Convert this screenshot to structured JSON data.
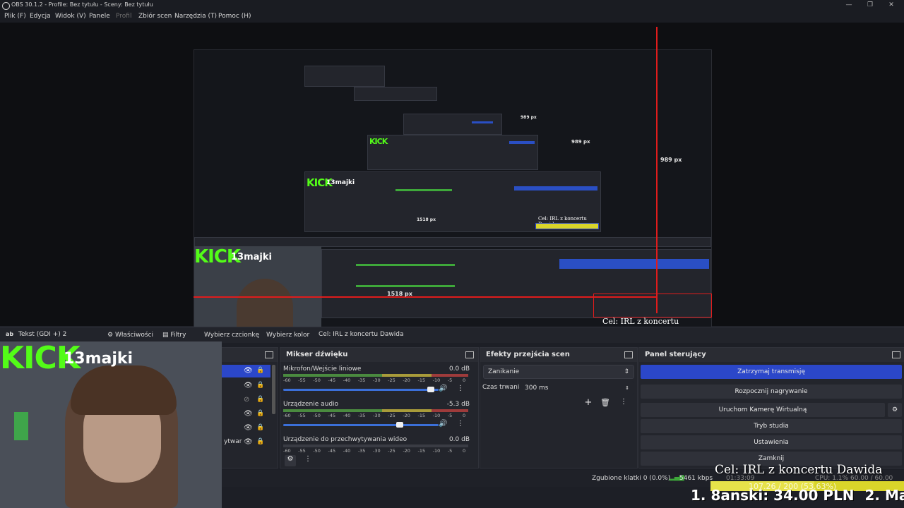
{
  "window": {
    "title": "OBS 30.1.2 - Profile: Bez tytułu - Sceny: Bez tytułu",
    "controls": [
      "—",
      "❐",
      "✕"
    ]
  },
  "menu": [
    {
      "label": "Plik (F)",
      "enabled": true
    },
    {
      "label": "Edycja",
      "enabled": true
    },
    {
      "label": "Widok (V)",
      "enabled": true
    },
    {
      "label": "Panele",
      "enabled": true
    },
    {
      "label": "Profil",
      "enabled": false
    },
    {
      "label": "Zbiór scen",
      "enabled": true
    },
    {
      "label": "Narzędzia (T)",
      "enabled": true
    },
    {
      "label": "Pomoc (H)",
      "enabled": true
    }
  ],
  "preview": {
    "measure_height": "989 px",
    "measure_width": "1518 px",
    "nested_height_2": "989 px",
    "nested_height_3": "989 px",
    "nested_width": "1518 px"
  },
  "properties_bar": {
    "source_icon": "ab",
    "source_name": "Tekst (GDI +) 2",
    "properties_label": "Właściwości",
    "filters_label": "Filtry",
    "choose_font_label": "Wybierz czcionkę",
    "choose_color_label": "Wybierz kolor",
    "text_value": "Cel: IRL z koncertu Dawida"
  },
  "sources": {
    "partial_item": "ytwar"
  },
  "mixer": {
    "title": "Mikser dźwięku",
    "channels": [
      {
        "name": "Mikrofon/Wejście liniowe",
        "db": "0.0 dB",
        "level": 0.79,
        "volume": 0.95
      },
      {
        "name": "Urządzenie audio",
        "db": "-5.3 dB",
        "level": 0.79,
        "volume": 0.76
      },
      {
        "name": "Urządzenie do przechwytywania wideo",
        "db": "0.0 dB",
        "level": 0.0,
        "volume": 0.0
      }
    ],
    "ticks": [
      "-60",
      "-55",
      "-50",
      "-45",
      "-40",
      "-35",
      "-30",
      "-25",
      "-20",
      "-15",
      "-10",
      "-5",
      "0"
    ]
  },
  "transitions": {
    "title": "Efekty przejścia scen",
    "selected": "Zanikanie",
    "duration_label": "Czas trwania",
    "duration_value": "300 ms"
  },
  "controls": {
    "title": "Panel sterujący",
    "stop_stream": "Zatrzymaj transmisję",
    "start_record": "Rozpocznij nagrywanie",
    "virtual_cam": "Uruchom Kamerę Wirtualną",
    "studio_mode": "Tryb studia",
    "settings": "Ustawienia",
    "exit": "Zamknij"
  },
  "status": {
    "dropped_frames": "Zgubione klatki 0 (0.0%)",
    "bitrate": "5461 kbps",
    "time": "01:33:09",
    "cpu": "CPU: 1.1%",
    "fps": "60.00 / 60.00 FPS"
  },
  "overlay": {
    "kick_logo": "KICK",
    "channel_name": "13majki",
    "goal_text": "Cel: IRL z koncertu Dawida",
    "goal_progress": "107.26 / 200 (53.63%)",
    "goal_fraction": 0.5363,
    "donor_line": "1. 8anski: 34.00 PLN",
    "donor_line_2": "2. Ma"
  },
  "colors": {
    "accent_blue": "#2b47c9",
    "kick_green": "#53fc18",
    "guide_red": "#e01c1c",
    "goal_yellow": "#d9d52a"
  }
}
